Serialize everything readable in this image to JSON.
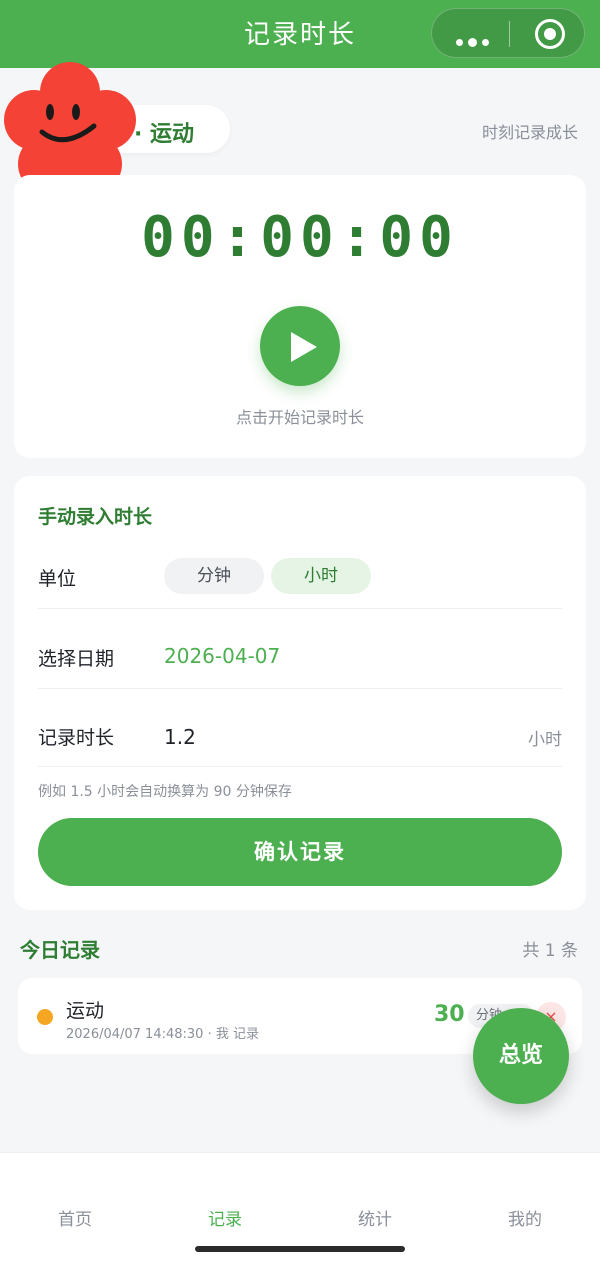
{
  "header": {
    "title": "记录时长"
  },
  "category_chip": {
    "label": "· 运动"
  },
  "slogan": "时刻记录成长",
  "timer": {
    "display": "00:00:00",
    "hint": "点击开始记录时长"
  },
  "manual": {
    "title": "手动录入时长",
    "unit_label": "单位",
    "unit_options": [
      "分钟",
      "小时"
    ],
    "selected_unit": "小时",
    "date_label": "选择日期",
    "date_value": "2026-04-07",
    "duration_label": "记录时长",
    "duration_value": "1.2",
    "duration_unit": "小时",
    "tip": "例如 1.5 小时会自动换算为 90 分钟保存",
    "confirm_label": "确认记录"
  },
  "today": {
    "title": "今日记录",
    "count": "共 1 条",
    "records": [
      {
        "name": "运动",
        "meta": "2026/04/07 14:48:30 · 我 记录",
        "value": "30",
        "unit": "分钟",
        "delete": "×",
        "dot_color": "#f5a623"
      }
    ]
  },
  "fab_label": "总览",
  "tabs": [
    {
      "label": "首页",
      "active": false
    },
    {
      "label": "记录",
      "active": true
    },
    {
      "label": "统计",
      "active": false
    },
    {
      "label": "我的",
      "active": false
    }
  ],
  "colors": {
    "brand": "#4caf50",
    "brand_dark": "#2e7d32",
    "accent_orange": "#f5a623"
  }
}
